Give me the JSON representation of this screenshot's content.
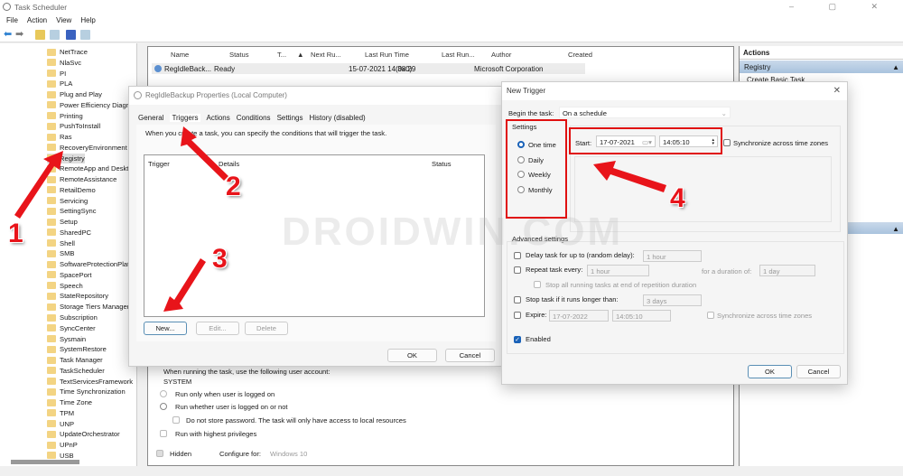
{
  "window": {
    "title": "Task Scheduler",
    "controls": "–  ▢  ✕"
  },
  "menu": [
    "File",
    "Action",
    "View",
    "Help"
  ],
  "tree": {
    "items": [
      "NetTrace",
      "NlaSvc",
      "PI",
      "PLA",
      "Plug and Play",
      "Power Efficiency Diagnostics",
      "Printing",
      "PushToInstall",
      "Ras",
      "RecoveryEnvironment",
      "Registry",
      "RemoteApp and Desktop Connections",
      "RemoteAssistance",
      "RetailDemo",
      "Servicing",
      "SettingSync",
      "Setup",
      "SharedPC",
      "Shell",
      "SMB",
      "SoftwareProtectionPlatform",
      "SpacePort",
      "Speech",
      "StateRepository",
      "Storage Tiers Management",
      "Subscription",
      "SyncCenter",
      "Sysmain",
      "SystemRestore",
      "Task Manager",
      "TaskScheduler",
      "TextServicesFramework",
      "Time Synchronization",
      "Time Zone",
      "TPM",
      "UNP",
      "UpdateOrchestrator",
      "UPnP",
      "USB"
    ],
    "selected": "Registry"
  },
  "tasklist": {
    "columns": [
      "Name",
      "Status",
      "T...",
      "Next Ru...",
      "Last Run Time",
      "Last Run...",
      "Author",
      "Created"
    ],
    "row": [
      "RegIdleBack...",
      "Ready",
      "",
      "",
      "15-07-2021 14:38:29",
      "(0x0)",
      "Microsoft Corporation",
      ""
    ]
  },
  "actions": {
    "title": "Actions",
    "section": "Registry",
    "item": "Create Basic Task..."
  },
  "properties": {
    "title": "RegIdleBackup Properties (Local Computer)",
    "tabs": [
      "General",
      "Triggers",
      "Actions",
      "Conditions",
      "Settings",
      "History (disabled)"
    ],
    "active_tab": "Triggers",
    "desc": "When you create a task, you can specify the conditions that will trigger the task.",
    "columns": [
      "Trigger",
      "Details",
      "Status"
    ],
    "new": "New...",
    "edit": "Edit...",
    "delete": "Delete",
    "ok": "OK",
    "cancel": "Cancel"
  },
  "general": {
    "account_label": "When running the task, use the following user account:",
    "account": "SYSTEM",
    "run_logged": "Run only when user is logged on",
    "run_whether": "Run whether user is logged on or not",
    "no_store": "Do not store password.  The task will only have access to local resources",
    "highest": "Run with highest privileges",
    "hidden": "Hidden",
    "configure_label": "Configure for:",
    "configure": "Windows 10"
  },
  "trigger": {
    "title": "New Trigger",
    "begin_label": "Begin the task:",
    "begin": "On a schedule",
    "settings_label": "Settings",
    "options": [
      "One time",
      "Daily",
      "Weekly",
      "Monthly"
    ],
    "selected": "One time",
    "start_label": "Start:",
    "start_date": "17-07-2021",
    "start_time": "14:05:10",
    "sync": "Synchronize across time zones",
    "advanced": "Advanced settings",
    "delay": "Delay task for up to (random delay):",
    "delay_val": "1 hour",
    "repeat": "Repeat task every:",
    "repeat_val": "1 hour",
    "duration_label": "for a duration of:",
    "duration_val": "1 day",
    "stop_all": "Stop all running tasks at end of repetition duration",
    "stop_longer": "Stop task if it runs longer than:",
    "stop_val": "3 days",
    "expire": "Expire:",
    "expire_date": "17-07-2022",
    "expire_time": "14:05:10",
    "expire_sync": "Synchronize across time zones",
    "enabled": "Enabled",
    "ok": "OK",
    "cancel": "Cancel"
  },
  "annotations": [
    "1",
    "2",
    "3",
    "4"
  ],
  "watermark": "DROIDWIN.COM",
  "colors": {
    "accent": "#1a62b8",
    "annotation": "#e8141a"
  }
}
